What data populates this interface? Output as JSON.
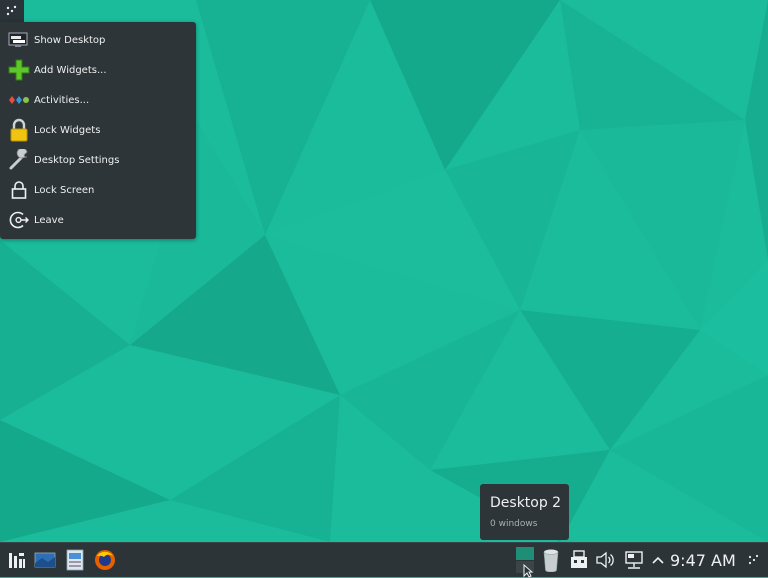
{
  "colors": {
    "wallpaper": "#1abc9c",
    "panel": "#2c3438",
    "menu": "#2e3538",
    "text": "#eff0f1",
    "text_dim": "#a8b0b3",
    "pager_active": "#1f8e76"
  },
  "menu": {
    "items": [
      {
        "label": "Show Desktop",
        "icon": "show-desktop-icon"
      },
      {
        "label": "Add Widgets...",
        "icon": "add-widgets-icon"
      },
      {
        "label": "Activities...",
        "icon": "activities-icon"
      },
      {
        "label": "Lock Widgets",
        "icon": "padlock-icon"
      },
      {
        "label": "Desktop Settings",
        "icon": "wrench-icon"
      },
      {
        "label": "Lock Screen",
        "icon": "lock-icon"
      },
      {
        "label": "Leave",
        "icon": "leave-icon"
      }
    ]
  },
  "tooltip": {
    "title": "Desktop 2",
    "subtitle": "0 windows"
  },
  "panel": {
    "launchers": [
      "application-launcher-icon",
      "desktop-icon",
      "file-manager-icon",
      "firefox-icon"
    ],
    "tray": [
      "pager-icon",
      "trash-icon",
      "usb-device-icon",
      "volume-icon",
      "network-icon",
      "expand-tray-icon"
    ],
    "clock": "9:47 AM"
  }
}
